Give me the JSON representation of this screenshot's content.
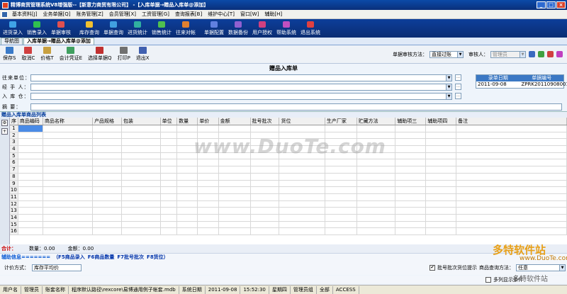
{
  "window": {
    "title": "精博商贸管理系统V8增强版--【新意力商贸有限公司】 -【入库单据→赠品入库单@添加】"
  },
  "menu": [
    "基本资料[J]",
    "业务单据[Q]",
    "账务管理[Z]",
    "会员管理[X]",
    "工资管理[G]",
    "查询报表[B]",
    "维护中心[T]",
    "窗口[W]",
    "辅助[H]"
  ],
  "toolbar": [
    {
      "label": "进货录入",
      "color": "#3fa3e6"
    },
    {
      "label": "销售录入",
      "color": "#30c050"
    },
    {
      "label": "单据审核",
      "color": "#e05050"
    },
    {
      "label": "库存查询",
      "color": "#f0c030"
    },
    {
      "label": "单据查询",
      "color": "#40a0e0"
    },
    {
      "label": "进货统计",
      "color": "#30b0a0"
    },
    {
      "label": "销售统计",
      "color": "#50c050"
    },
    {
      "label": "往来对帐",
      "color": "#e08030"
    },
    {
      "label": "单据配置",
      "color": "#6080e0"
    },
    {
      "label": "数据备份",
      "color": "#9060d0"
    },
    {
      "label": "用户授权",
      "color": "#d04080"
    },
    {
      "label": "帮助系统",
      "color": "#c050c0"
    },
    {
      "label": "退出系统",
      "color": "#e04040"
    }
  ],
  "tabs": [
    "导航图",
    "入库单据→赠品入库单@添加"
  ],
  "doctool": {
    "buttons": [
      {
        "label": "保存S",
        "color": "#3a7ac8"
      },
      {
        "label": "取消C",
        "color": "#d04040"
      },
      {
        "label": "价格T",
        "color": "#c8a040"
      },
      {
        "label": "会计凭证E",
        "color": "#40a060"
      },
      {
        "label": "选择单据Q",
        "color": "#c03030"
      },
      {
        "label": "打印P",
        "color": "#707070"
      },
      {
        "label": "退出X",
        "color": "#4060b0"
      }
    ],
    "audit_method_label": "单据审核方法：",
    "audit_method_value": "直接过账",
    "auditor_label": "审核人：",
    "auditor_value": "管理员"
  },
  "form": {
    "title": "赠品入库单",
    "partner_label": "往来单位：",
    "handler_label": "经 手 人：",
    "warehouse_label": "入 库 仓：",
    "memo_label": "摘    要：",
    "date_header": "录单日期",
    "no_header": "单据编号",
    "date_value": "2011-09-08",
    "no_value": "ZPRK20110908001"
  },
  "grid": {
    "section_title": "赠品入库单商品列表",
    "columns": [
      "序",
      "商品编码",
      "商品名称",
      "产品规格",
      "包装",
      "单位",
      "数量",
      "单价",
      "金额",
      "批号批次",
      "货位",
      "生产厂家",
      "贮藏方法",
      "辅助项三",
      "辅助项四",
      "备注"
    ],
    "row_numbers": [
      "1",
      "2",
      "3",
      "4",
      "5",
      "6",
      "7",
      "8",
      "9",
      "10",
      "11",
      "12",
      "13",
      "14",
      "15",
      "16"
    ]
  },
  "totals": {
    "label": "合计：",
    "qty": "数量：0.00",
    "amount": "金额：0.00"
  },
  "hotkeys": {
    "label": "辅助信息=======",
    "items": [
      "（F5商品录入",
      "F6商品数量",
      "F7批号批次",
      "F8货位）"
    ]
  },
  "cost": {
    "label": "计价方式：",
    "value": "库存平均价"
  },
  "options": {
    "batch_label": "批号批次货位提示",
    "batch_checked": "✔",
    "query_label": "商品查询方法：",
    "query_value": "任意",
    "multi_label": "多列显示条件"
  },
  "status": [
    "用户名",
    "管理员",
    "账套名称",
    "程序默认路径\\rexcore\\易博通用例子帐套.mdb",
    "系统日期",
    "2011-09-08",
    "15:52:30",
    "星期四",
    "管理员组",
    "全部",
    "ACCESS"
  ],
  "watermarks": {
    "center": "www.DuoTe.com",
    "brand": "多特软件站",
    "brand_url": "www.DuoTe.com",
    "brand_site": "多特软件站"
  }
}
